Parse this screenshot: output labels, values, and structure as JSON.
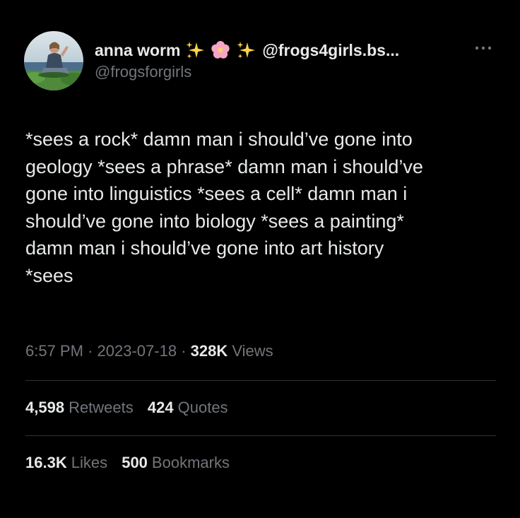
{
  "author": {
    "display_name": "anna worm",
    "name_handle": "@frogs4girls.bs...",
    "handle": "@frogsforgirls",
    "avatar": "avatar-photo",
    "name_emojis": [
      "sparkles-emoji",
      "blossom-emoji",
      "sparkles-emoji"
    ]
  },
  "tweet": {
    "text": "*sees a rock* damn man i should’ve gone into\ngeology *sees a phrase* damn man i should’ve\ngone into linguistics *sees a cell* damn man i\nshould’ve gone into biology *sees a painting*\ndamn man i should’ve gone into art history\n*sees"
  },
  "meta": {
    "time": "6:57 PM",
    "separator": "·",
    "date": "2023-07-18",
    "views_count": "328K",
    "views_label": "Views"
  },
  "stats": {
    "retweets_count": "4,598",
    "retweets_label": "Retweets",
    "quotes_count": "424",
    "quotes_label": "Quotes",
    "likes_count": "16.3K",
    "likes_label": "Likes",
    "bookmarks_count": "500",
    "bookmarks_label": "Bookmarks"
  },
  "icons": {
    "more": "more-options-icon"
  },
  "colors": {
    "background": "#000000",
    "primary_text": "#e7e9ea",
    "secondary_text": "#71767b",
    "divider": "#2f3336"
  }
}
